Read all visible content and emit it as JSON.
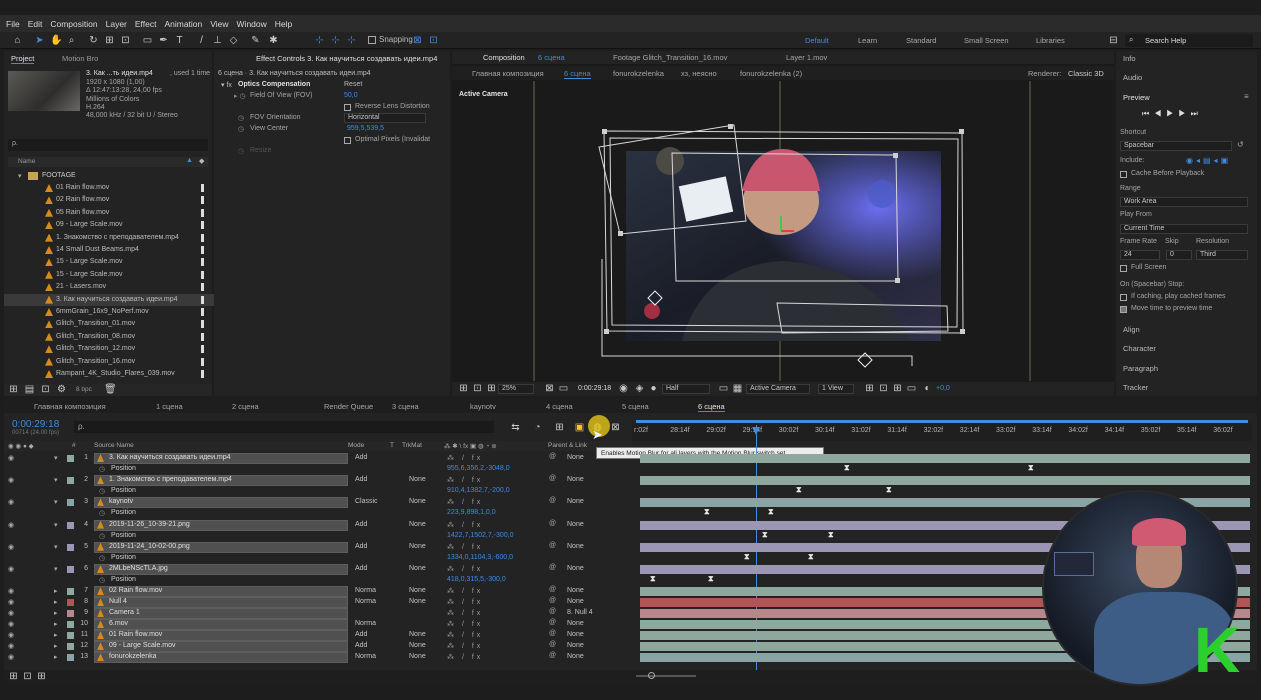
{
  "menu": [
    "File",
    "Edit",
    "Composition",
    "Layer",
    "Effect",
    "Animation",
    "View",
    "Window",
    "Help"
  ],
  "toolbar": {
    "snapping": "Snapping",
    "workspaces": [
      "Default",
      "Learn",
      "Standard",
      "Small Screen",
      "Libraries"
    ],
    "search": "Search Help"
  },
  "project": {
    "tab1": "Project",
    "tab2": "Motion Bro",
    "selected_name": "3. Как ...ть идеи.mp4",
    "used": ", used 1 time",
    "info": [
      "1920 x 1080 (1,00)",
      "Δ 12:47:13:28, 24,00 fps",
      "Millions of Colors",
      "H.264",
      "48,000 kHz / 32 bit U / Stereo"
    ],
    "search": "ρ.",
    "col_name": "Name",
    "folder": "FOOTAGE",
    "items": [
      "01 Rain flow.mov",
      "02 Rain flow.mov",
      "05 Rain flow.mov",
      "09 - Large Scale.mov",
      "1. Знакомство с преподавателем.mp4",
      "14 Small Dust Beams.mp4",
      "15 - Large Scale.mov",
      "15 - Large Scale.mov",
      "21 - Lasers.mov",
      "3. Как научиться создавать идеи.mp4",
      "6mmGrain_16x9_NoPerf.mov",
      "Glitch_Transition_01.mov",
      "Glitch_Transition_08.mov",
      "Glitch_Transition_12.mov",
      "Glitch_Transition_16.mov",
      "Rampant_4K_Studio_Flares_039.mov"
    ],
    "bpc": "8 bpc"
  },
  "effects": {
    "tab": "Effect Controls 3. Как научиться создавать идеи.mp4",
    "sub": "6 сцена · 3. Как научиться создавать идеи.mp4",
    "fx": "Optics Compensation",
    "reset": "Reset",
    "fov_label": "Field Of View (FOV)",
    "fov": "50,0",
    "reverse": "Reverse Lens Distortion",
    "orient_label": "FOV Orientation",
    "orient": "Horizontal",
    "center_label": "View Center",
    "center": "959,5,539,5",
    "optimal": "Optimal Pixels (Invalidat",
    "resize": "Resize"
  },
  "comp": {
    "tab": "Composition",
    "tab_name": "6 сцена",
    "footage": "Footage Glitch_Transition_16.mov",
    "layer": "Layer 1.mov",
    "breadcrumbs": [
      "Главная композиция",
      "6 сцена",
      "fonurokzelenka",
      "хз, неясно",
      "fonurokzelenka (2)"
    ],
    "renderer_label": "Renderer:",
    "renderer": "Classic 3D",
    "active_camera": "Active Camera",
    "zoom": "25%",
    "time": "0:00:29:18",
    "res": "Half",
    "view_cam": "Active Camera",
    "views": "1 View",
    "exposure": "+0,0"
  },
  "right": {
    "info": "Info",
    "audio": "Audio",
    "preview": "Preview",
    "shortcut_label": "Shortcut",
    "shortcut": "Spacebar",
    "include": "Include:",
    "cache": "Cache Before Playback",
    "range_label": "Range",
    "range": "Work Area",
    "play_from_label": "Play From",
    "play_from": "Current Time",
    "fr_label": "Frame Rate",
    "skip_label": "Skip",
    "res_label": "Resolution",
    "fr": "24",
    "skip": "0",
    "res": "Third",
    "full": "Full Screen",
    "stop": "On (Spacebar) Stop:",
    "if_caching": "If caching, play cached frames",
    "move_time": "Move time to preview time",
    "align": "Align",
    "character": "Character",
    "paragraph": "Paragraph",
    "tracker": "Tracker"
  },
  "timeline": {
    "tabs": [
      "Главная композиция",
      "1 сцена",
      "2 сцена",
      "Render Queue",
      "3 сцена",
      "kaynotv",
      "4 сцена",
      "5 сцена",
      "6 сцена"
    ],
    "time": "0:00:29:18",
    "frames": "00714 (24.00 fps)",
    "col_source": "Source Name",
    "col_mode": "Mode",
    "col_t": "T",
    "col_trkmat": "TrkMat",
    "col_parent": "Parent & Link",
    "tooltip": "Enables Motion Blur for all layers with the Motion Blur switch set",
    "ruler": [
      "r:02f",
      "28:14f",
      "29:02f",
      "29:14f",
      "30:02f",
      "30:14f",
      "31:02f",
      "31:14f",
      "32:02f",
      "32:14f",
      "33:02f",
      "33:14f",
      "34:02f",
      "34:14f",
      "35:02f",
      "35:14f",
      "36:02f"
    ],
    "position": "Position",
    "layers": [
      {
        "num": "1",
        "name": "3. Как научиться создавать идеи.mp4",
        "mode": "Add",
        "trk": "",
        "parent": "None",
        "pos": "955,6,356,2,-3048,0",
        "color": "#8ea89d"
      },
      {
        "num": "2",
        "name": "1. Знакомство с преподавателем.mp4",
        "mode": "Add",
        "trk": "None",
        "parent": "None",
        "pos": "910,4,1382,7,-200,0",
        "color": "#8ea89d"
      },
      {
        "num": "3",
        "name": "kaynotv",
        "mode": "Classic",
        "trk": "None",
        "parent": "None",
        "pos": "223,9,898,1,0,0",
        "color": "#8aa3a5"
      },
      {
        "num": "4",
        "name": "2019-11-26_10-39-21.png",
        "mode": "Add",
        "trk": "None",
        "parent": "None",
        "pos": "1422,7,1502,7,-300,0",
        "color": "#9a96b4"
      },
      {
        "num": "5",
        "name": "2019-11-24_10-02-00.png",
        "mode": "Add",
        "trk": "None",
        "parent": "None",
        "pos": "1334,0,1104,3,-600,0",
        "color": "#9a96b4"
      },
      {
        "num": "6",
        "name": "2MLbeNScTLA.jpg",
        "mode": "Add",
        "trk": "None",
        "parent": "None",
        "pos": "418,0,315,5,-300,0",
        "color": "#9a96b4"
      },
      {
        "num": "7",
        "name": "02 Rain flow.mov",
        "mode": "Norma",
        "trk": "None",
        "parent": "None",
        "color": "#8ea89d"
      },
      {
        "num": "8",
        "name": "Null 4",
        "mode": "Norma",
        "trk": "None",
        "parent": "None",
        "color": "#b25456"
      },
      {
        "num": "9",
        "name": "Camera 1",
        "mode": "",
        "trk": "",
        "parent": "8. Null 4",
        "color": "#b8878b"
      },
      {
        "num": "10",
        "name": "6.mov",
        "mode": "Norma",
        "trk": "",
        "parent": "None",
        "color": "#8ea89d"
      },
      {
        "num": "11",
        "name": "01 Rain flow.mov",
        "mode": "Add",
        "trk": "None",
        "parent": "None",
        "color": "#8ea89d"
      },
      {
        "num": "12",
        "name": "09 - Large Scale.mov",
        "mode": "Add",
        "trk": "None",
        "parent": "None",
        "color": "#8ea89d"
      },
      {
        "num": "13",
        "name": "fonurokzelenka",
        "mode": "Norma",
        "trk": "None",
        "parent": "None",
        "color": "#8aa3a5"
      }
    ]
  },
  "logo": "K"
}
